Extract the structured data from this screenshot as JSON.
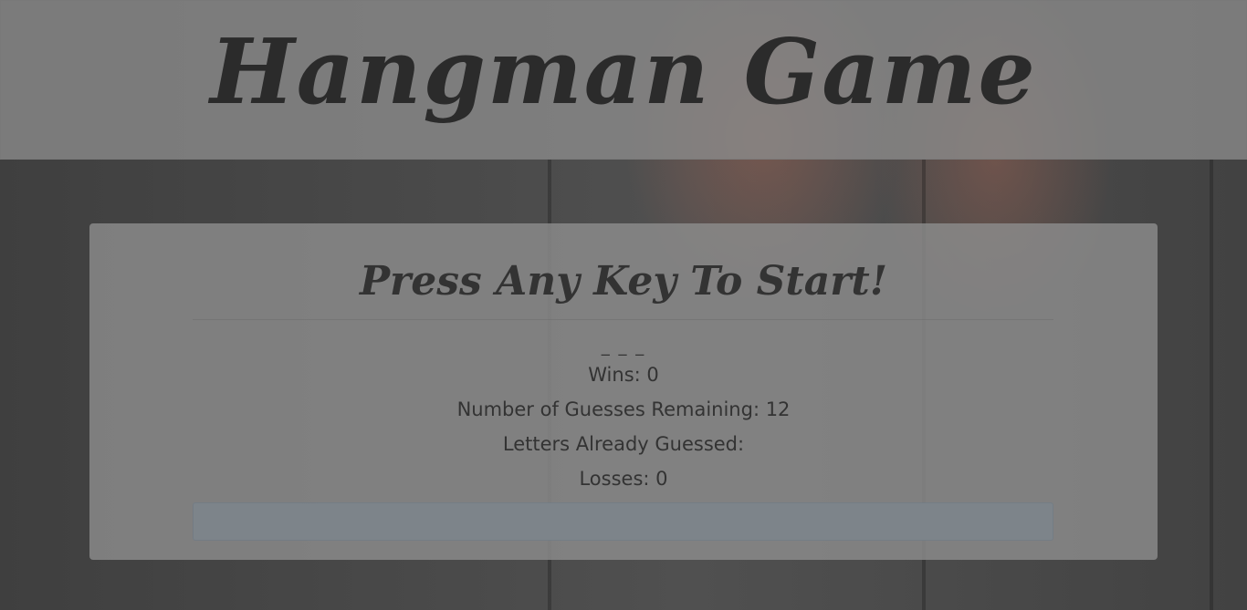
{
  "header": {
    "title": "Hangman Game"
  },
  "game": {
    "prompt": "Press Any Key To Start!",
    "word_blanks": "_ _ _",
    "wins": "Wins: 0",
    "guesses_remaining": "Number of Guesses Remaining: 12",
    "letters_guessed": "Letters Already Guessed:",
    "losses": "Losses: 0"
  },
  "colors": {
    "text": "#333333",
    "panel": "#8c8c8c",
    "alert_bar": "#7d858c"
  }
}
